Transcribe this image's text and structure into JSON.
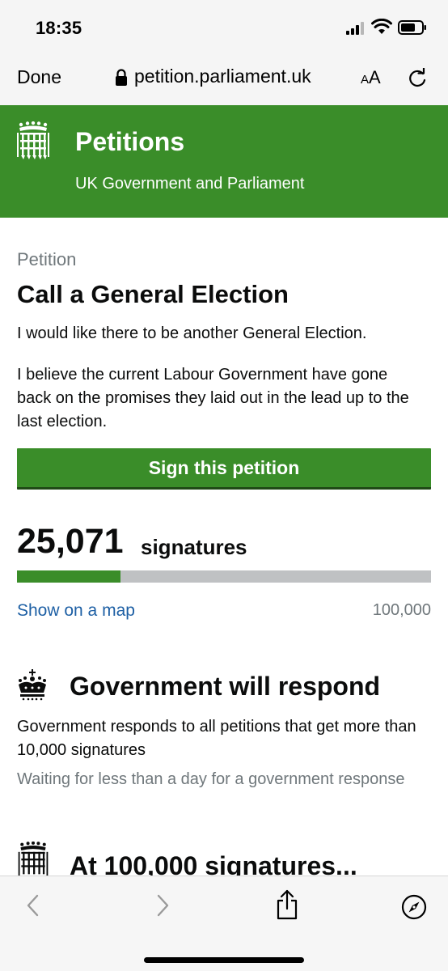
{
  "status_bar": {
    "time": "18:35"
  },
  "browser": {
    "done_label": "Done",
    "url": "petition.parliament.uk",
    "text_size_small": "A",
    "text_size_big": "A"
  },
  "header": {
    "title": "Petitions",
    "subtitle": "UK Government and Parliament"
  },
  "petition": {
    "label": "Petition",
    "title": "Call a General Election",
    "action": "I would like there to be another General Election.",
    "background": "I believe the current Labour Government have gone back on the promises they laid out in the lead up to the last election.",
    "sign_button_label": "Sign this petition"
  },
  "signatures": {
    "count": "25,071",
    "label": "signatures",
    "progress_fraction": 0.2507,
    "map_link": "Show on a map",
    "threshold": "100,000"
  },
  "government_response": {
    "heading": "Government will respond",
    "body": "Government responds to all petitions that get more than 10,000 signatures",
    "waiting": "Waiting for less than a day for a government response"
  },
  "debate": {
    "heading": "At 100,000 signatures..."
  },
  "icons": {
    "crest": "portcullis-icon",
    "crown": "crown-icon",
    "lock": "lock-icon",
    "reload": "reload-icon",
    "back": "chevron-left-icon",
    "forward": "chevron-right-icon",
    "share": "share-icon",
    "compass": "compass-icon"
  },
  "colors": {
    "brand_green": "#3a8d29",
    "link_blue": "#1d5fa4",
    "muted_grey": "#6f777b",
    "progress_track": "#bfc1c3"
  }
}
